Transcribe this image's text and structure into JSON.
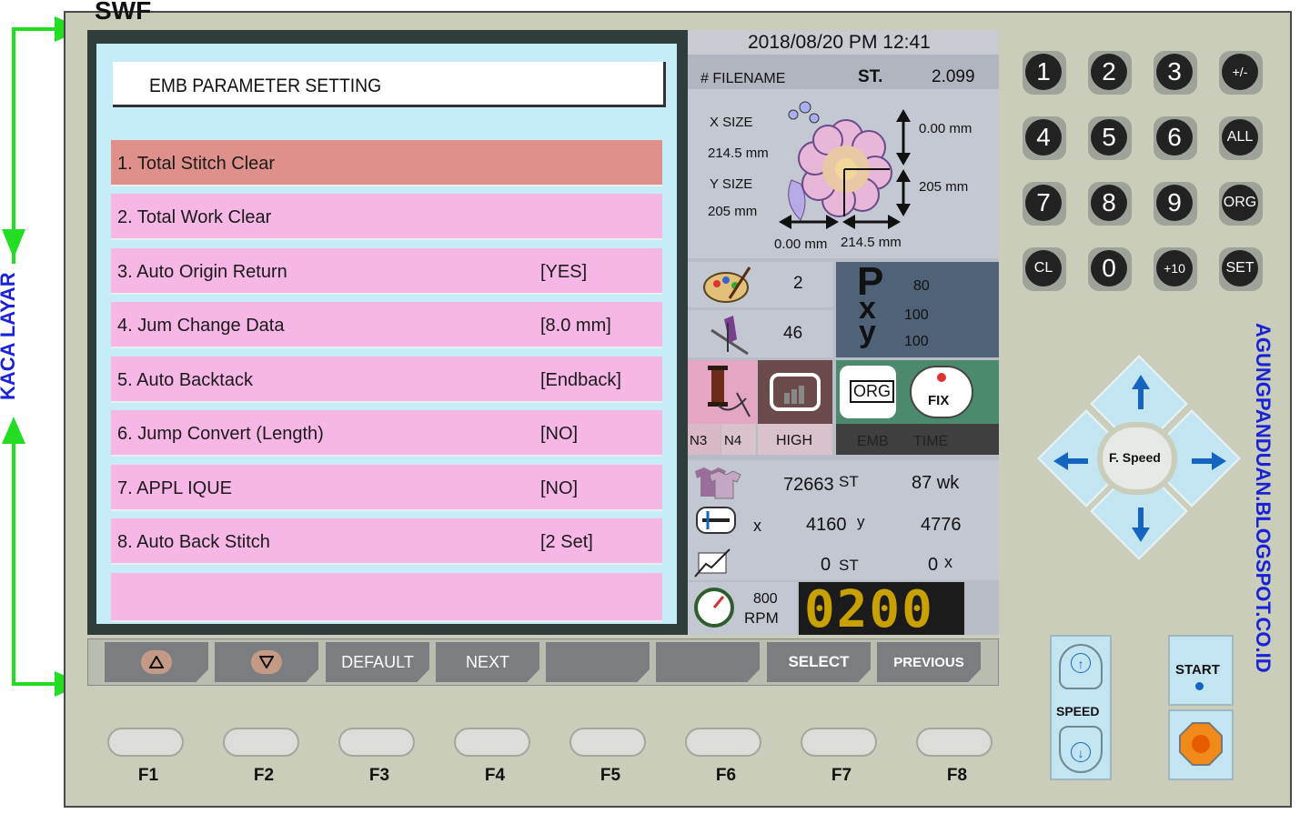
{
  "brand": "SWF",
  "screen": {
    "title": "EMB PARAMETER SETTING",
    "rows": [
      {
        "label": "1. Total Stitch Clear",
        "value": ""
      },
      {
        "label": "2. Total Work Clear",
        "value": ""
      },
      {
        "label": "3. Auto  Origin Return",
        "value": "[YES]"
      },
      {
        "label": "4. Jum Change Data",
        "value": "[8.0 mm]"
      },
      {
        "label": "5. Auto Backtack",
        "value": "[Endback]"
      },
      {
        "label": "6. Jump Convert (Length)",
        "value": "[NO]"
      },
      {
        "label": "7. APPL IQUE",
        "value": "[NO]"
      },
      {
        "label": "8. Auto Back Stitch",
        "value": "[2 Set]"
      },
      {
        "label": "",
        "value": ""
      }
    ]
  },
  "info": {
    "datetime": "2018/08/20 PM 12:41",
    "filename_label": "# FILENAME",
    "st_label": "ST.",
    "st_value": "2.099",
    "x_size_label": "X   SIZE",
    "x_size_value": "214.5 mm",
    "y_size_label": "Y   SIZE",
    "y_size_value": "205 mm",
    "dim_top_right": "0.00 mm",
    "dim_mid_right": "205 mm",
    "dim_bottom_left": "0.00 mm",
    "dim_bottom_right": "214.5 mm",
    "color_count": "2",
    "needle_count": "46",
    "p_label": "P",
    "x_label": "x",
    "y_label": "y",
    "p_value": "80",
    "x_value": "100",
    "y_value": "100",
    "n3": "N3",
    "n4": "N4",
    "high": "HIGH",
    "org": "ORG",
    "fix": "FIX",
    "emb": "EMB",
    "time": "TIME",
    "total_st": "72663",
    "st_unit": "ST",
    "wk": "87 wk",
    "x_unit": "x",
    "pos_x": "4160",
    "y_unit": "y",
    "pos_y": "4776",
    "cur_st": "0",
    "cur_st_unit": "ST",
    "cur_x": "0",
    "cur_x_unit": "x",
    "rpm_value": "800",
    "rpm_label": "RPM",
    "counter": "0200"
  },
  "softkeys": {
    "default": "DEFAULT",
    "next": "NEXT",
    "select": "SELECT",
    "previous": "PREVIOUS"
  },
  "fkeys": [
    "F1",
    "F2",
    "F3",
    "F4",
    "F5",
    "F6",
    "F7",
    "F8"
  ],
  "keypad": [
    "1",
    "2",
    "3",
    "+/-",
    "4",
    "5",
    "6",
    "ALL",
    "7",
    "8",
    "9",
    "ORG",
    "CL",
    "0",
    "+10",
    "SET"
  ],
  "dpad_center": "F. Speed",
  "speed_label": "SPEED",
  "start_label": "START",
  "annotation_left": "KACA LAYAR",
  "annotation_right": "AGUNGPANDUAN.BLOGSPOT.CO.ID",
  "colors": {
    "panel": "#c9cdb9",
    "screen_bg": "#c6ecf8",
    "row_bg": "#f6b6e6",
    "row_selected": "#e0908a",
    "annotation": "#1a22d8",
    "arrow_green": "#22dd22",
    "counter_digits": "#c8a000"
  }
}
